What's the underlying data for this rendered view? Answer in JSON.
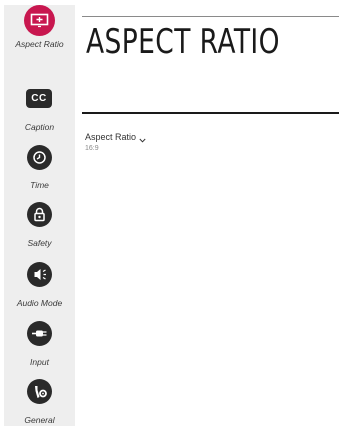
{
  "sidebar": {
    "items": [
      {
        "label": "Aspect Ratio",
        "icon": "aspect-ratio-icon",
        "active": true
      },
      {
        "label": "Caption",
        "icon": "cc-icon",
        "icon_text": "CC"
      },
      {
        "label": "Time",
        "icon": "clock-icon"
      },
      {
        "label": "Safety",
        "icon": "lock-icon"
      },
      {
        "label": "Audio Mode",
        "icon": "speaker-icon"
      },
      {
        "label": "Input",
        "icon": "input-plug-icon"
      },
      {
        "label": "General",
        "icon": "tools-icon"
      }
    ]
  },
  "main": {
    "title": "ASPECT RATIO",
    "setting": {
      "name": "Aspect Ratio",
      "value": "16:9"
    }
  },
  "colors": {
    "accent": "#c8174f",
    "icon_dark": "#2a2a2a",
    "sidebar_bg": "#eeeeee"
  }
}
